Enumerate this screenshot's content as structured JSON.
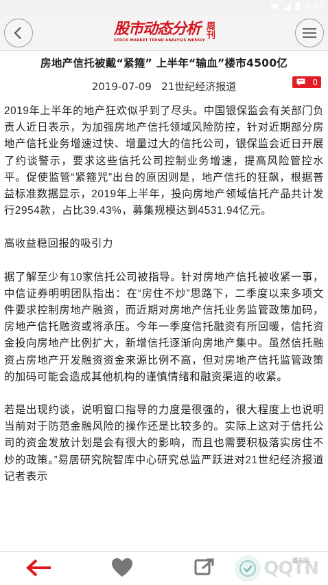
{
  "status_bar": {
    "time": "3:57"
  },
  "header": {
    "logo_text": "股市动态分析",
    "logo_subtitle": "STOCK MARKET TREND ANALYSIS WEEKLY",
    "logo_week": "周刊",
    "back_icon": "chevron-left-icon",
    "menu_icon": "hamburger-icon"
  },
  "article": {
    "title": "房地产信托被戴“紧箍” 上半年“输血”楼市4500亿",
    "date": "2019-07-09",
    "source": "21世纪经济报道",
    "comment_count": "0",
    "paragraphs": [
      "2019年上半年的地产狂欢似乎到了尽头。中国银保监会有关部门负责人近日表示，为加强房地产信托领域风险防控，针对近期部分房地产信托业务增速过快、增量过大的信托公司，银保监会近日开展了约谈警示，要求这些信托公司控制业务增速，提高风险管控水平。促使监管“紧箍咒”出台的原因则是，地产信托的狂飙，根据普益标准数据显示，2019年上半年，投向房地产领域信托产品共计发行2954款，占比39.43%，募集规模达到4531.94亿元。",
      "高收益稳回报的吸引力",
      "据了解至少有10家信托公司被指导。针对房地产信托被收紧一事，中信证券明明团队指出：在“房住不炒”思路下，二季度以来多项文件要求控制房地产融资，而近期对房地产信托业务监管政策加码，房地产信托融资或将承压。今年一季度信托融资有所回暖，信托资金投向房地产比例扩大，新增信托逐渐向房地产集中。虽然信托融资占房地产开发融资资金来源比例不高，但对房地产信托监管政策的加码可能会造成其他机构的谨慎情绪和融资渠道的收紧。",
      "若是出现约谈，说明窗口指导的力度是很强的，很大程度上也说明当前对于防范金融风险的操作还是比较多的。实际上这对于信托公司的资金发放计划是会有很大的影响，而且也需要积极落实房住不炒的政策。”易居研究院智库中心研究总监严跃进对21世纪经济报道记者表示"
    ]
  },
  "bottom_bar": {
    "back_icon": "arrow-left-icon",
    "like_icon": "heart-icon",
    "share_icon": "share-icon"
  },
  "watermark": {
    "text": "QQTN",
    "small": "腾牛网"
  },
  "colors": {
    "brand_red": "#d4141e",
    "badge_red": "#e21d26"
  }
}
